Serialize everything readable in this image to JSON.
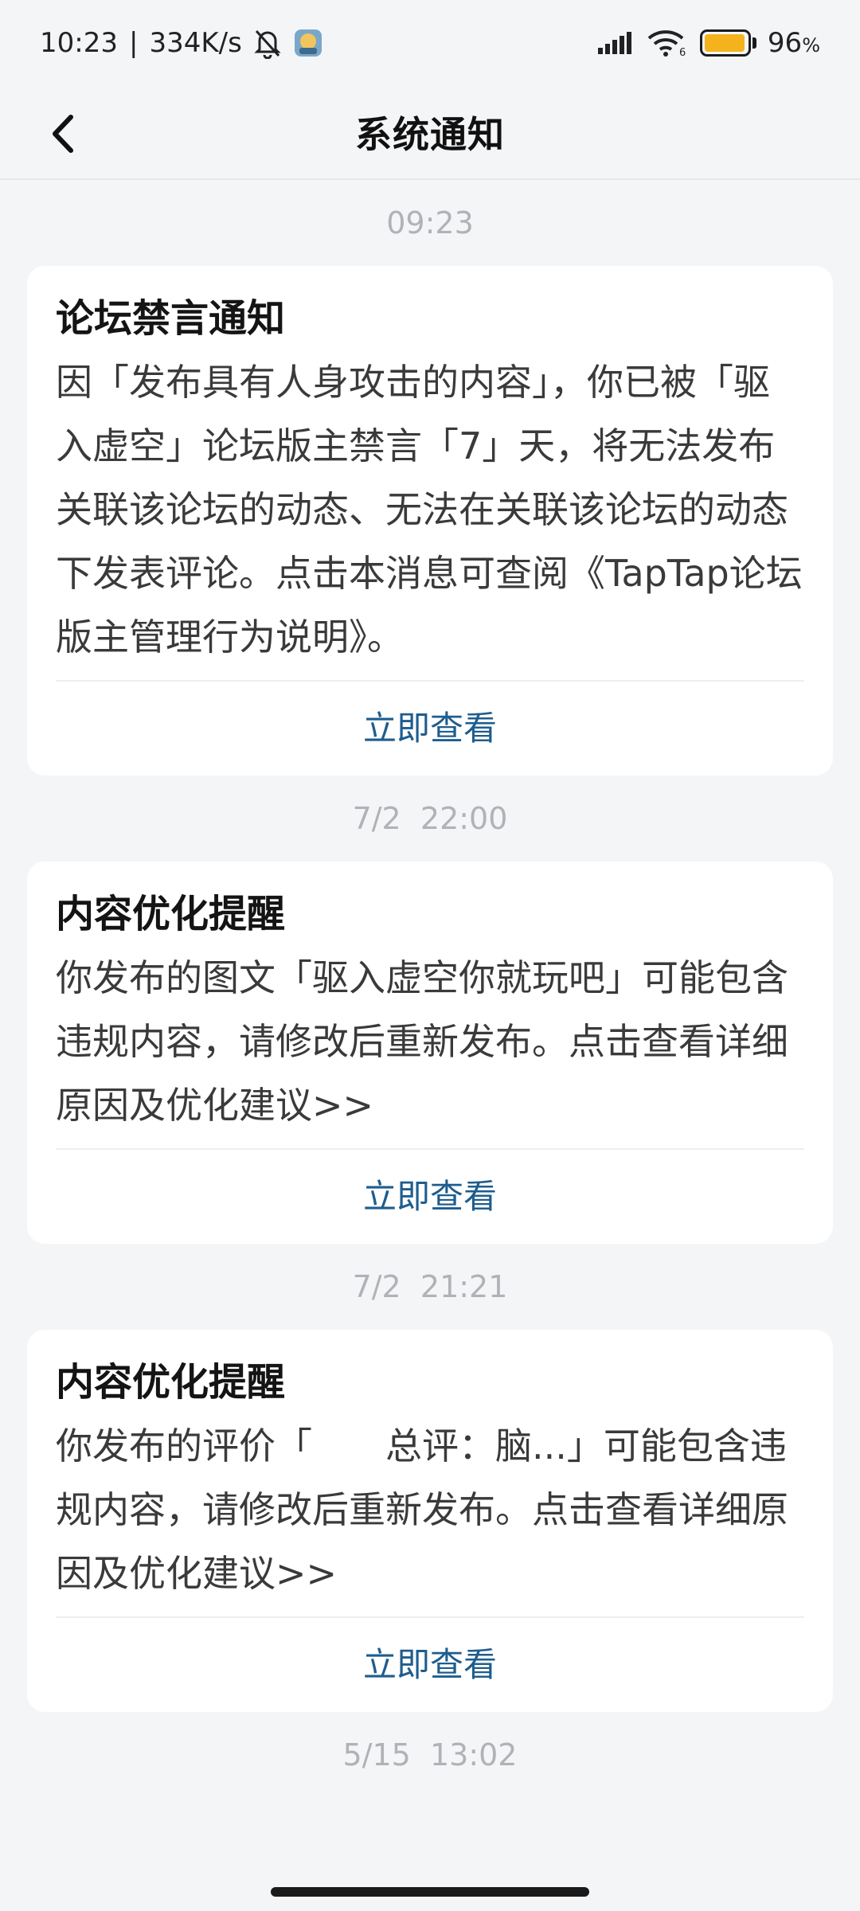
{
  "status_bar": {
    "time": "10:23",
    "net_speed": "334K/s",
    "battery_percent": "96",
    "battery_suffix": "%",
    "battery_level": 0.96
  },
  "header": {
    "title": "系统通知"
  },
  "notifications": [
    {
      "time": "09:23",
      "title": "论坛禁言通知",
      "body": "因「发布具有人身攻击的内容」，你已被「驱入虚空」论坛版主禁言「7」天，将无法发布关联该论坛的动态、无法在关联该论坛的动态下发表评论。点击本消息可查阅《TapTap论坛版主管理行为说明》。",
      "action": "立即查看"
    },
    {
      "time": "7/2  22:00",
      "title": "内容优化提醒",
      "body": "你发布的图文「驱入虚空你就玩吧」可能包含违规内容，请修改后重新发布。点击查看详细原因及优化建议>>",
      "action": "立即查看"
    },
    {
      "time": "7/2  21:21",
      "title": "内容优化提醒",
      "body": "你发布的评价「　　总评：脑...」可能包含违规内容，请修改后重新发布。点击查看详细原因及优化建议>>",
      "action": "立即查看"
    },
    {
      "time": "5/15  13:02"
    }
  ],
  "colors": {
    "accent_link": "#1e5d8e",
    "background": "#f4f5f7",
    "card": "#ffffff",
    "battery": "#f4b31c"
  },
  "icons": {
    "back": "chevron-left-icon",
    "notification_muted": "bell-off-icon",
    "signal": "signal-icon",
    "wifi": "wifi-icon",
    "battery": "battery-icon"
  }
}
